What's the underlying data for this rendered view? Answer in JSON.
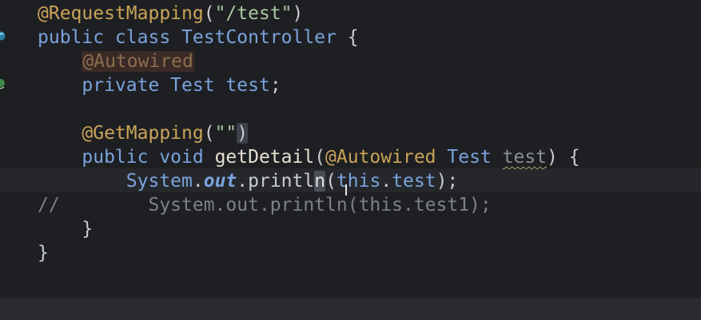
{
  "editor": {
    "lines": [
      {
        "indent": "",
        "tokens": [
          {
            "cls": "ann",
            "t": "@RequestMapping"
          },
          {
            "cls": "plain",
            "t": "("
          },
          {
            "cls": "str",
            "t": "\"/test\""
          },
          {
            "cls": "plain",
            "t": ")"
          }
        ]
      },
      {
        "indent": "",
        "tokens": [
          {
            "cls": "kw",
            "t": "public class "
          },
          {
            "cls": "type",
            "t": "TestController "
          },
          {
            "cls": "plain",
            "t": "{"
          }
        ]
      },
      {
        "indent": "    ",
        "tokens": [
          {
            "cls": "unused",
            "t": "@Autowired"
          }
        ]
      },
      {
        "indent": "    ",
        "tokens": [
          {
            "cls": "kw",
            "t": "private "
          },
          {
            "cls": "type",
            "t": "Test "
          },
          {
            "cls": "kw",
            "t": "test"
          },
          {
            "cls": "plain",
            "t": ";"
          }
        ]
      },
      {
        "indent": "",
        "tokens": []
      },
      {
        "indent": "    ",
        "tokens": [
          {
            "cls": "ann",
            "t": "@GetMapping"
          },
          {
            "cls": "plain",
            "t": "("
          },
          {
            "cls": "str",
            "t": "\"\""
          },
          {
            "cls": "paren-match",
            "t": ")"
          }
        ]
      },
      {
        "indent": "    ",
        "tokens": [
          {
            "cls": "kw",
            "t": "public void "
          },
          {
            "cls": "fn",
            "t": "getDetail"
          },
          {
            "cls": "plain",
            "t": "("
          },
          {
            "cls": "ann",
            "t": "@Autowired "
          },
          {
            "cls": "type",
            "t": "Test "
          },
          {
            "cls": "squiggle",
            "t": "test"
          },
          {
            "cls": "plain",
            "t": ") {"
          }
        ]
      },
      {
        "indent": "        ",
        "tokens": [
          {
            "cls": "type",
            "t": "System"
          },
          {
            "cls": "plain",
            "t": "."
          },
          {
            "cls": "field",
            "t": "out"
          },
          {
            "cls": "plain",
            "t": ".printl"
          },
          {
            "cls": "caret-char",
            "t": "n"
          },
          {
            "cls": "plain",
            "t": "("
          },
          {
            "cls": "kw",
            "t": "this"
          },
          {
            "cls": "plain",
            "t": "."
          },
          {
            "cls": "kw",
            "t": "test"
          },
          {
            "cls": "plain",
            "t": ");"
          }
        ]
      },
      {
        "indent": "",
        "tokens": [
          {
            "cls": "comment",
            "t": "//        System.out.println(this.test1);"
          }
        ]
      },
      {
        "indent": "    ",
        "tokens": [
          {
            "cls": "plain",
            "t": "}"
          }
        ]
      },
      {
        "indent": "",
        "tokens": [
          {
            "cls": "plain",
            "t": "}"
          }
        ]
      }
    ]
  },
  "gutter_icons": [
    {
      "line": 1,
      "icon": "spring-bean-icon",
      "color": "#3ea3c8"
    },
    {
      "line": 3,
      "icon": "autowired-navigation-icon",
      "color": "#5aa35a"
    }
  ]
}
